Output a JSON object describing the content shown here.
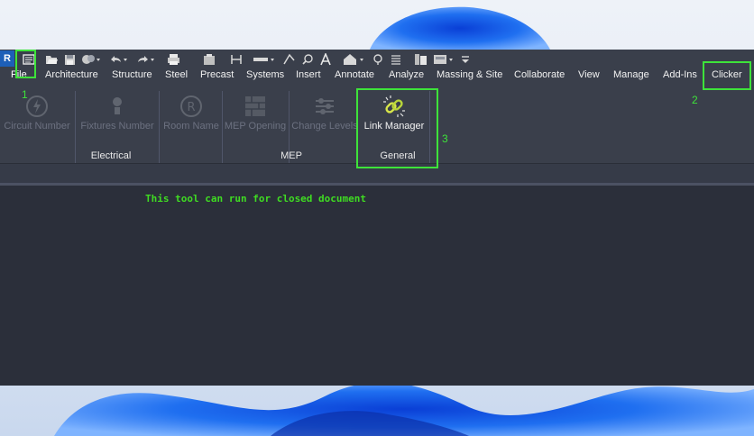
{
  "quick_access": {
    "logo": "R",
    "icons": [
      "recent-files-icon",
      "open-icon",
      "save-icon",
      "sync-icon",
      "undo-icon",
      "redo-icon",
      "print-icon",
      "properties-icon",
      "measure-icon",
      "dimension-icon",
      "tag-icon",
      "text-icon",
      "home-view-icon",
      "section-icon",
      "thin-lines-icon",
      "switch-windows-icon",
      "customize-icon"
    ]
  },
  "ribbon_tabs": [
    {
      "label": "File"
    },
    {
      "label": "Architecture"
    },
    {
      "label": "Structure"
    },
    {
      "label": "Steel"
    },
    {
      "label": "Precast"
    },
    {
      "label": "Systems"
    },
    {
      "label": "Insert"
    },
    {
      "label": "Annotate"
    },
    {
      "label": "Analyze"
    },
    {
      "label": "Massing & Site"
    },
    {
      "label": "Collaborate"
    },
    {
      "label": "View"
    },
    {
      "label": "Manage"
    },
    {
      "label": "Add-Ins"
    },
    {
      "label": "Clicker"
    }
  ],
  "panels": [
    {
      "label": "Electrical",
      "tools": [
        {
          "label": "Circuit Number",
          "icon": "circuit-icon"
        },
        {
          "label": "Fixtures Number",
          "icon": "fixtures-icon"
        },
        {
          "label": "Room Name",
          "icon": "room-icon"
        }
      ]
    },
    {
      "label": "MEP",
      "tools": [
        {
          "label": "MEP Opening",
          "icon": "opening-icon"
        },
        {
          "label": "Change Levels",
          "icon": "levels-icon"
        }
      ]
    },
    {
      "label": "General",
      "tools": [
        {
          "label": "Link Manager",
          "icon": "link-icon"
        }
      ]
    }
  ],
  "annotations": {
    "markers": [
      "1",
      "2",
      "3"
    ],
    "message": "This tool can run for closed document",
    "highlight_color": "#3ee33a"
  },
  "colors": {
    "ribbon_bg": "#3a3f4b",
    "file_tab": "#1e68c8",
    "canvas_bg": "#2b2f3a"
  }
}
